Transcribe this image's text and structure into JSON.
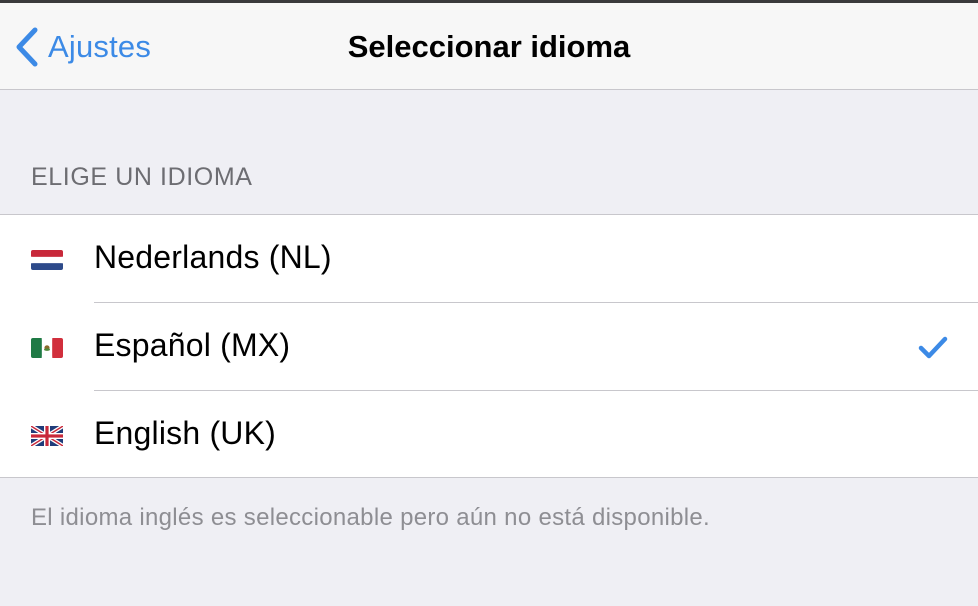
{
  "navigation": {
    "back_label": "Ajustes",
    "back_icon": "chevron-left-icon",
    "title": "Seleccionar idioma"
  },
  "section": {
    "header": "ELIGE UN IDIOMA",
    "languages": [
      {
        "label": "Nederlands (NL)",
        "flag": "netherlands-flag-icon",
        "selected": false
      },
      {
        "label": "Español (MX)",
        "flag": "mexico-flag-icon",
        "selected": true
      },
      {
        "label": "English (UK)",
        "flag": "uk-flag-icon",
        "selected": false
      }
    ],
    "footer": "El idioma inglés es seleccionable pero aún no está disponible."
  },
  "colors": {
    "accent": "#3c8ae6",
    "background": "#efeff4",
    "navbar": "#f7f7f7",
    "separator": "#c8c7cc",
    "secondary_text": "#6d6d72",
    "footer_text": "#8e8e93"
  }
}
